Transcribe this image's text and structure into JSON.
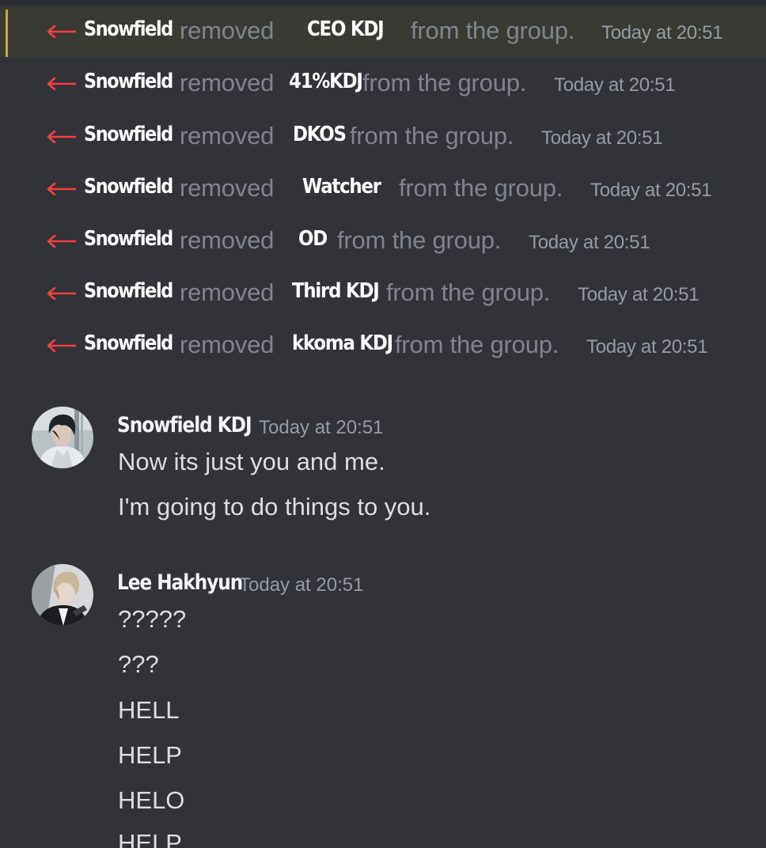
{
  "system_messages": [
    {
      "actor": "Snowfield",
      "verb": "removed",
      "target": "CEO KDJ",
      "rest": "from the group.",
      "timestamp": "Today at 20:51",
      "highlighted": true
    },
    {
      "actor": "Snowfield",
      "verb": "removed",
      "target": "41%KDJ",
      "rest": "from the group.",
      "timestamp": "Today at 20:51"
    },
    {
      "actor": "Snowfield",
      "verb": "removed",
      "target": "DKOS",
      "rest": "from the group.",
      "timestamp": "Today at 20:51"
    },
    {
      "actor": "Snowfield",
      "verb": "removed",
      "target": "Watcher",
      "rest": "from the group.",
      "timestamp": "Today at 20:51"
    },
    {
      "actor": "Snowfield",
      "verb": "removed",
      "target": "OD",
      "rest": "from the group.",
      "timestamp": "Today at 20:51"
    },
    {
      "actor": "Snowfield",
      "verb": "removed",
      "target": "Third KDJ",
      "rest": "from the group.",
      "timestamp": "Today at 20:51"
    },
    {
      "actor": "Snowfield",
      "verb": "removed",
      "target": "kkoma KDJ",
      "rest": "from the group.",
      "timestamp": "Today at 20:51"
    }
  ],
  "messages": [
    {
      "author": "Snowfield KDJ",
      "timestamp": "Today at 20:51",
      "avatar_icon": "user-avatar-dark-hair",
      "lines": [
        "Now its just you and me.",
        "I'm going to do things to you."
      ]
    },
    {
      "author": "Lee Hakhyun",
      "timestamp": "Today at 20:51",
      "avatar_icon": "user-avatar-light-hair",
      "lines": [
        "?????",
        "???",
        "HELL",
        "HELP",
        "HELO",
        "HELP"
      ]
    }
  ],
  "colors": {
    "background": "#313338",
    "leave_arrow": "#f23f43",
    "highlight_bar": "#c9a34a",
    "muted_text": "#80848e",
    "timestamp": "#949ba4",
    "message_text": "#dbdee1",
    "name_text": "#ffffff"
  }
}
